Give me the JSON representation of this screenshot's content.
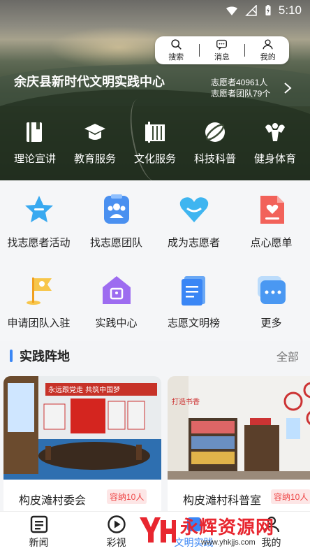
{
  "status_bar": {
    "time": "5:10"
  },
  "top_actions": [
    {
      "label": "搜索",
      "icon": "search-icon"
    },
    {
      "label": "消息",
      "icon": "message-icon"
    },
    {
      "label": "我的",
      "icon": "user-icon"
    }
  ],
  "center": {
    "title": "余庆县新时代文明实践中心",
    "stats": [
      "志愿者40961人",
      "志愿者团队79个"
    ]
  },
  "categories": [
    {
      "label": "理论宣讲",
      "icon": "book-icon"
    },
    {
      "label": "教育服务",
      "icon": "graduation-cap-icon"
    },
    {
      "label": "文化服务",
      "icon": "culture-icon"
    },
    {
      "label": "科技科普",
      "icon": "planet-icon"
    },
    {
      "label": "健身体育",
      "icon": "fitness-icon"
    }
  ],
  "grid": [
    {
      "label": "找志愿者活动",
      "icon": "star-icon"
    },
    {
      "label": "找志愿团队",
      "icon": "team-icon"
    },
    {
      "label": "成为志愿者",
      "icon": "heart-icon"
    },
    {
      "label": "点心愿单",
      "icon": "wish-list-icon"
    },
    {
      "label": "申请团队入驻",
      "icon": "flag-icon"
    },
    {
      "label": "实践中心",
      "icon": "home-icon"
    },
    {
      "label": "志愿文明榜",
      "icon": "document-icon"
    },
    {
      "label": "更多",
      "icon": "more-icon"
    }
  ],
  "section": {
    "title": "实践阵地",
    "all_label": "全部"
  },
  "cards": [
    {
      "name": "构皮滩村委会",
      "badge": "容纳10人",
      "banner_text": "永远跟党走  共筑中国梦"
    },
    {
      "name": "构皮滩村科普室",
      "badge": "容纳10人",
      "banner_text": "打造书香"
    }
  ],
  "tabs": [
    {
      "label": "新闻",
      "icon": "news-icon"
    },
    {
      "label": "彩视",
      "icon": "play-icon"
    },
    {
      "label": "文明实践",
      "icon": "practice-icon"
    },
    {
      "label": "我的",
      "icon": "profile-icon"
    }
  ],
  "watermark": {
    "text": "永辉资源网",
    "url": "www.yhkjjs.com"
  },
  "colors": {
    "accent": "#3a86f5",
    "badge": "#e44444",
    "watermark": "#e8262f"
  }
}
